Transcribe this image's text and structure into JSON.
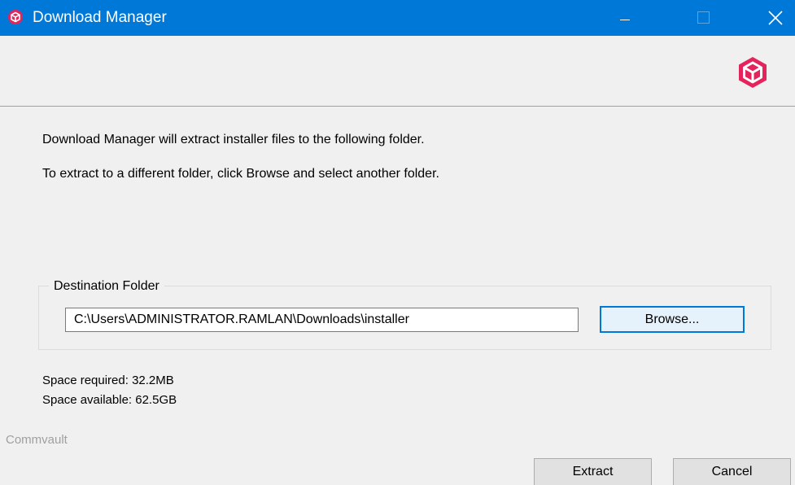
{
  "window": {
    "title": "Download Manager",
    "app_icon": "commvault-cube-icon",
    "controls": [
      "minimize",
      "maximize",
      "close"
    ]
  },
  "header": {
    "logo": "commvault-cube-icon",
    "logo_color": "#e4245a"
  },
  "content": {
    "message_line1": "Download Manager will extract installer files to the following folder.",
    "message_line2": "To extract to a different folder, click Browse and select another folder."
  },
  "destination": {
    "group_label": "Destination Folder",
    "path": "C:\\Users\\ADMINISTRATOR.RAMLAN\\Downloads\\installer",
    "browse_label": "Browse..."
  },
  "space": {
    "required": "Space required: 32.2MB",
    "available": "Space available: 62.5GB"
  },
  "footer": {
    "brand": "Commvault",
    "extract_label": "Extract",
    "cancel_label": "Cancel"
  },
  "colors": {
    "titlebar": "#0078d7",
    "accent": "#e4245a",
    "background": "#f0f0f0"
  }
}
